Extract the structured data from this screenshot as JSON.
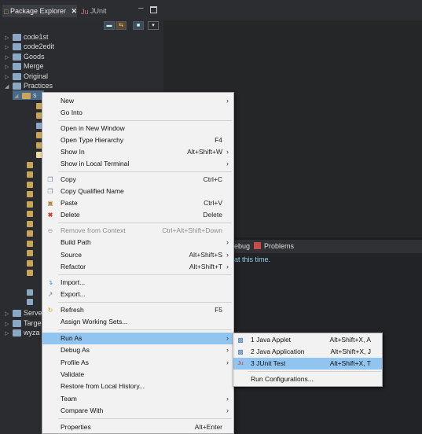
{
  "tabs": {
    "package_explorer": "Package Explorer",
    "junit": "JUnit"
  },
  "tree": [
    {
      "label": "code1st",
      "kind": "project"
    },
    {
      "label": "code2edit",
      "kind": "project"
    },
    {
      "label": "Goods",
      "kind": "project"
    },
    {
      "label": "Merge",
      "kind": "project"
    },
    {
      "label": "Original",
      "kind": "project"
    },
    {
      "label": "Practices",
      "kind": "project",
      "expanded": true
    },
    {
      "label": "s",
      "kind": "folder",
      "selected": true
    }
  ],
  "tree_partial": {
    "serve": "Serve",
    "targe": "Targe",
    "wyza": "wyza"
  },
  "bottom_panel": {
    "debug_tab": "ebug",
    "problems_tab": "Problems",
    "message": "at this time."
  },
  "context_menu": {
    "items": [
      {
        "label": "New",
        "shortcut": "",
        "submenu": true,
        "icon": ""
      },
      {
        "label": "Go Into",
        "shortcut": "",
        "submenu": false,
        "icon": ""
      },
      {
        "label": "Open in New Window",
        "shortcut": "",
        "submenu": false,
        "icon": ""
      },
      {
        "label": "Open Type Hierarchy",
        "shortcut": "F4",
        "submenu": false,
        "icon": ""
      },
      {
        "label": "Show In",
        "shortcut": "Alt+Shift+W",
        "submenu": true,
        "icon": ""
      },
      {
        "label": "Show in Local Terminal",
        "shortcut": "",
        "submenu": true,
        "icon": ""
      },
      {
        "label": "Copy",
        "shortcut": "Ctrl+C",
        "submenu": false,
        "icon": "copy-icon"
      },
      {
        "label": "Copy Qualified Name",
        "shortcut": "",
        "submenu": false,
        "icon": "copy-qualified-icon"
      },
      {
        "label": "Paste",
        "shortcut": "Ctrl+V",
        "submenu": false,
        "icon": "paste-icon"
      },
      {
        "label": "Delete",
        "shortcut": "Delete",
        "submenu": false,
        "icon": "delete-icon"
      },
      {
        "label": "Remove from Context",
        "shortcut": "Ctrl+Alt+Shift+Down",
        "submenu": false,
        "icon": "remove-context-icon",
        "disabled": true
      },
      {
        "label": "Build Path",
        "shortcut": "",
        "submenu": true,
        "icon": ""
      },
      {
        "label": "Source",
        "shortcut": "Alt+Shift+S",
        "submenu": true,
        "icon": ""
      },
      {
        "label": "Refactor",
        "shortcut": "Alt+Shift+T",
        "submenu": true,
        "icon": ""
      },
      {
        "label": "Import...",
        "shortcut": "",
        "submenu": false,
        "icon": "import-icon"
      },
      {
        "label": "Export...",
        "shortcut": "",
        "submenu": false,
        "icon": "export-icon"
      },
      {
        "label": "Refresh",
        "shortcut": "F5",
        "submenu": false,
        "icon": "refresh-icon"
      },
      {
        "label": "Assign Working Sets...",
        "shortcut": "",
        "submenu": false,
        "icon": ""
      },
      {
        "label": "Run As",
        "shortcut": "",
        "submenu": true,
        "icon": "",
        "highlighted": true
      },
      {
        "label": "Debug As",
        "shortcut": "",
        "submenu": true,
        "icon": ""
      },
      {
        "label": "Profile As",
        "shortcut": "",
        "submenu": true,
        "icon": ""
      },
      {
        "label": "Validate",
        "shortcut": "",
        "submenu": false,
        "icon": ""
      },
      {
        "label": "Restore from Local History...",
        "shortcut": "",
        "submenu": false,
        "icon": ""
      },
      {
        "label": "Team",
        "shortcut": "",
        "submenu": true,
        "icon": ""
      },
      {
        "label": "Compare With",
        "shortcut": "",
        "submenu": true,
        "icon": ""
      },
      {
        "label": "Properties",
        "shortcut": "Alt+Enter",
        "submenu": false,
        "icon": ""
      }
    ]
  },
  "run_as_submenu": {
    "items": [
      {
        "label": "1 Java Applet",
        "shortcut": "Alt+Shift+X, A",
        "icon": "java-applet-icon"
      },
      {
        "label": "2 Java Application",
        "shortcut": "Alt+Shift+X, J",
        "icon": "java-application-icon"
      },
      {
        "label": "3 JUnit Test",
        "shortcut": "Alt+Shift+X, T",
        "icon": "junit-icon",
        "highlighted": true
      },
      {
        "label": "Run Configurations...",
        "shortcut": "",
        "icon": ""
      }
    ]
  },
  "colors": {
    "menu_bg": "#f2f2f2",
    "highlight": "#92c4f0",
    "dark_bg": "#1e1f22"
  }
}
